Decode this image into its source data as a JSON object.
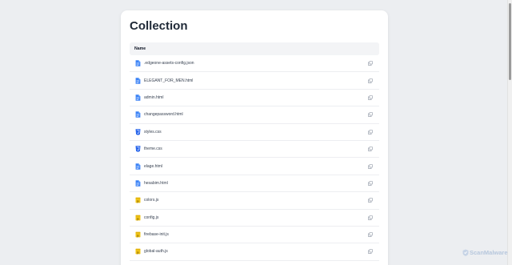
{
  "page": {
    "title": "Collection"
  },
  "table": {
    "header_name": "Name",
    "rows": [
      {
        "name": ".edgeone-assets-config.json",
        "icon": "file-icon"
      },
      {
        "name": "ELEGANT_FOR_MEN.html",
        "icon": "file-icon"
      },
      {
        "name": "admin.html",
        "icon": "file-icon"
      },
      {
        "name": "changepassword.html",
        "icon": "file-icon"
      },
      {
        "name": "styles.css",
        "icon": "css-icon"
      },
      {
        "name": "theme.css",
        "icon": "css-icon"
      },
      {
        "name": "elage.html",
        "icon": "file-icon"
      },
      {
        "name": "hesabim.html",
        "icon": "file-icon"
      },
      {
        "name": "colors.js",
        "icon": "js-icon"
      },
      {
        "name": "config.js",
        "icon": "js-icon"
      },
      {
        "name": "firebase-init.js",
        "icon": "js-icon"
      },
      {
        "name": "global-auth.js",
        "icon": "js-icon"
      }
    ]
  },
  "watermark": {
    "text": "ScanMalware"
  },
  "colors": {
    "file_icon": "#3b82f6",
    "css_icon": "#2563eb",
    "js_icon": "#f0c419",
    "copy_icon": "#9ca3af"
  }
}
